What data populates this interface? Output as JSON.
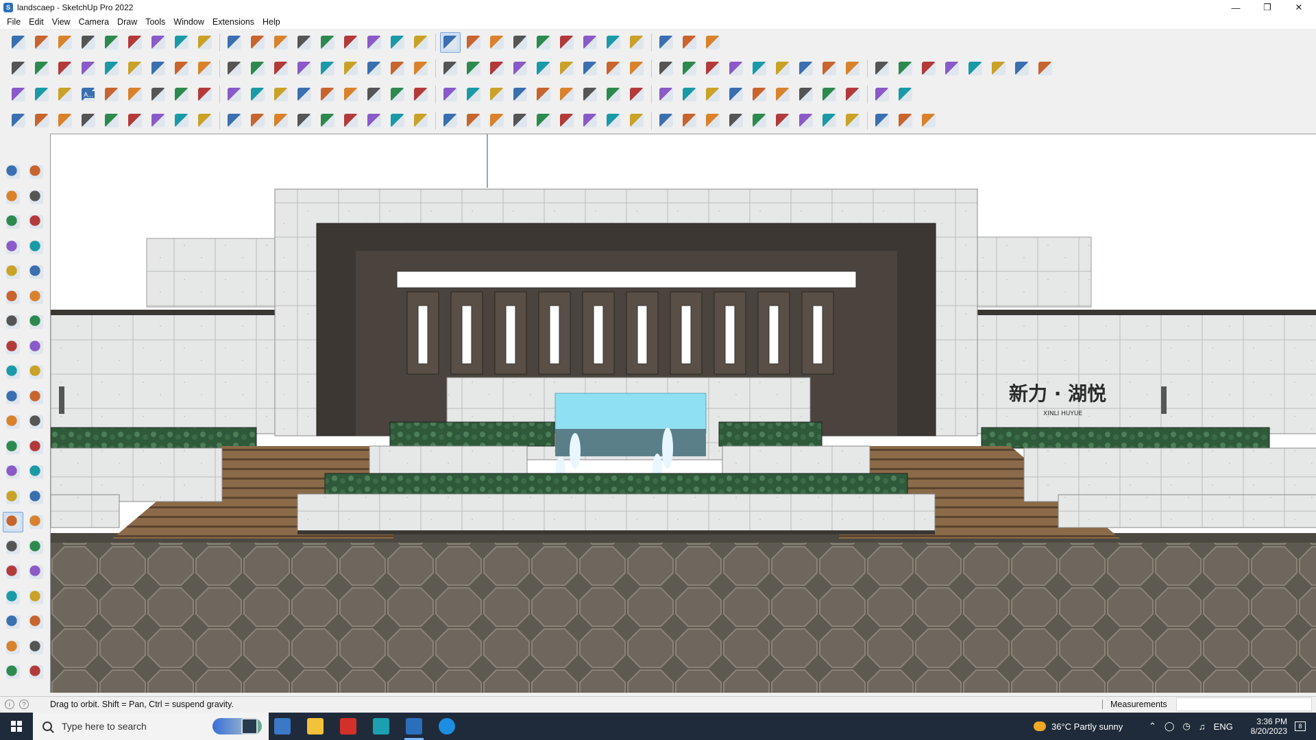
{
  "window": {
    "title": "landscaep - SketchUp Pro 2022",
    "app_icon": "sketchup-icon",
    "controls": [
      "minimize-icon",
      "restore-icon",
      "close-icon"
    ]
  },
  "menu": [
    "File",
    "Edit",
    "View",
    "Camera",
    "Draw",
    "Tools",
    "Window",
    "Extensions",
    "Help"
  ],
  "toolbars": {
    "row1": {
      "first_icon": "zoom-icon",
      "active_icon": "orbit-icon",
      "color": "#3a6fb0",
      "count": 30
    },
    "row2": {
      "color": "#c8642d",
      "count": 44
    },
    "row3": {
      "color": "#d9822b",
      "count": 38
    },
    "row4": {
      "color": "#555555",
      "count": 39
    },
    "row3_label": "A..."
  },
  "left_toolbar": {
    "active": "orbit-tool-icon",
    "tools": [
      "select-icon",
      "orbit-icon",
      "paint-bucket-icon",
      "eraser-icon",
      "component-icon",
      "tape-measure-icon",
      "line-icon",
      "freehand-icon",
      "rectangle-icon",
      "rotated-rectangle-icon",
      "circle-icon",
      "polygon-icon",
      "arc-icon",
      "arc-2pt-icon",
      "pie-icon",
      "3pt-arc-icon",
      "move-icon",
      "push-pull-icon",
      "rotate-icon",
      "follow-me-icon",
      "scale-icon",
      "offset-icon",
      "tape-icon",
      "text-icon",
      "protractor-icon",
      "3d-text-icon",
      "axes-icon",
      "dimension-icon",
      "orbit-tool-icon",
      "pan-icon",
      "zoom-icon",
      "zoom-window-icon",
      "zoom-extents-icon",
      "previous-view-icon",
      "position-camera-icon",
      "look-around-icon",
      "walk-icon",
      "section-plane-icon",
      "display-section-icon",
      "section-cuts-icon",
      "layers-icon",
      "styles-icon"
    ]
  },
  "viewport": {
    "scene": "landscape-entrance-model",
    "signage_text": "新力 · 湖悦",
    "signage_subtext": "XINLI HUYUE",
    "sky_color": "#ffffff",
    "stone_color": "#e4e6e6",
    "paving_color": "#5e5a52"
  },
  "status": {
    "message": "Drag to orbit. Shift = Pan, Ctrl = suspend gravity.",
    "measurements_label": "Measurements",
    "measurements_value": ""
  },
  "taskbar": {
    "search_placeholder": "Type here to search",
    "apps": [
      "task-view-icon",
      "calculator-icon",
      "file-explorer-icon",
      "acrobat-icon",
      "3ds-max-icon",
      "sketchup-icon",
      "edge-icon"
    ],
    "active_app": "sketchup-icon",
    "weather": "36°C  Partly sunny",
    "language": "ENG",
    "time": "3:36 PM",
    "date": "8/20/2023",
    "notifications": "8"
  }
}
